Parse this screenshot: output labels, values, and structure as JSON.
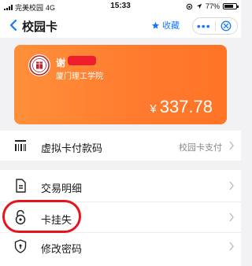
{
  "status_bar": {
    "carrier": "完美校园",
    "network": "4G",
    "time": "15:33",
    "battery": "77%",
    "battery_level": 0.77
  },
  "nav": {
    "title": "校园卡",
    "favorite_label": "收藏",
    "more_label": "•••"
  },
  "card": {
    "holder_name": "谢",
    "school": "厦门理工学院",
    "currency_symbol": "¥",
    "balance": "337.78",
    "colors": {
      "start": "#ff8f3a",
      "end": "#ff7426"
    }
  },
  "menu": {
    "virtual_card": {
      "label": "虚拟卡付款码",
      "value": "校园卡支付"
    },
    "transactions": {
      "label": "交易明细"
    },
    "report_loss": {
      "label": "卡挂失"
    },
    "change_password": {
      "label": "修改密码"
    }
  },
  "accent_color": "#1677ff",
  "annotation_color": "#e8141c"
}
